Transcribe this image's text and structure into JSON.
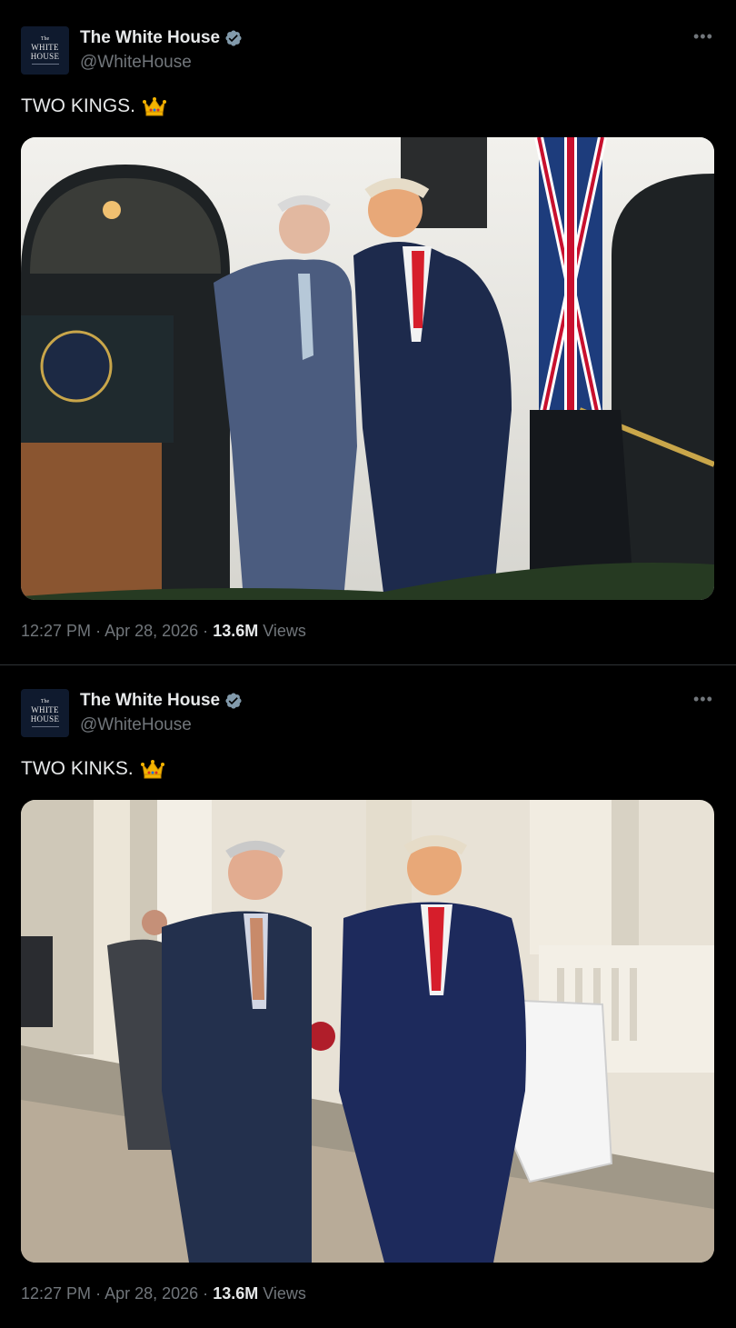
{
  "tweets": [
    {
      "author_name": "The White House",
      "author_handle": "@WhiteHouse",
      "avatar_lines": [
        "The",
        "WHITE",
        "HOUSE"
      ],
      "text": "TWO KINGS.",
      "emoji": "crown-emoji",
      "image_alt": "Two men in suits on a stage in front of a white building with a lectern and a Union Jack flag",
      "time": "12:27 PM",
      "date": "Apr 28, 2026",
      "views_count": "13.6M",
      "views_label": "Views"
    },
    {
      "author_name": "The White House",
      "author_handle": "@WhiteHouse",
      "avatar_lines": [
        "The",
        "WHITE",
        "HOUSE"
      ],
      "text": "TWO KINKS.",
      "emoji": "crown-emoji",
      "image_alt": "Two men in dark suits walking along a path beside a cream building, a third man behind them",
      "time": "12:27 PM",
      "date": "Apr 28, 2026",
      "views_count": "13.6M",
      "views_label": "Views"
    }
  ],
  "more_icon": "more-horizontal-icon",
  "verified_icon": "verified-badge-icon",
  "colors": {
    "background": "#000000",
    "text": "#e7e9ea",
    "muted": "#71767b",
    "verified": "#829aab",
    "divider": "#2f3336"
  }
}
